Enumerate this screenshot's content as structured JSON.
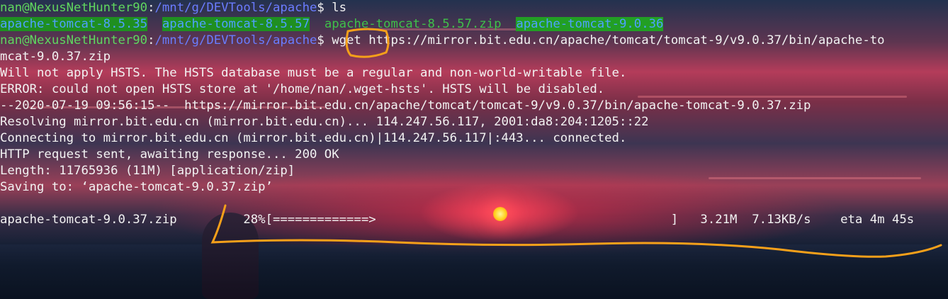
{
  "terminal": {
    "prompt_user": "nan@NexusNetHunter90",
    "prompt_sep": ":",
    "cwd": "/mnt/g/DEVTools/apache",
    "prompt_char": "$",
    "cmd1": " ls",
    "ls_items": [
      "apache-tomcat-8.5.35",
      "apache-tomcat-8.5.57",
      "apache-tomcat-8.5.57.zip",
      "apache-tomcat-9.0.36"
    ],
    "cmd2_keyword": "wget",
    "cmd2_url": " https://mirror.bit.edu.cn/apache/tomcat/tomcat-9/v9.0.37/bin/apache-to",
    "cmd2_wrap": "mcat-9.0.37.zip",
    "out1": "Will not apply HSTS. The HSTS database must be a regular and non-world-writable file.",
    "out2": "ERROR: could not open HSTS store at '/home/nan/.wget-hsts'. HSTS will be disabled.",
    "out3": "--2020-07-19 09:56:15--  https://mirror.bit.edu.cn/apache/tomcat/tomcat-9/v9.0.37/bin/apache-tomcat-9.0.37.zip",
    "out4": "Resolving mirror.bit.edu.cn (mirror.bit.edu.cn)... 114.247.56.117, 2001:da8:204:1205::22",
    "out5": "Connecting to mirror.bit.edu.cn (mirror.bit.edu.cn)|114.247.56.117|:443... connected.",
    "out6": "HTTP request sent, awaiting response... 200 OK",
    "out7": "Length: 11765936 (11M) [application/zip]",
    "out8": "Saving to: ‘apache-tomcat-9.0.37.zip’",
    "progress": {
      "filename": "apache-tomcat-9.0.37.zip",
      "percent": "28%",
      "bar": "[=============>                                        ]",
      "downloaded": "3.21M",
      "speed": "7.13KB/s",
      "eta": "eta 4m 45s",
      "fraction": 0.28
    }
  },
  "colors": {
    "user": "#5fd75f",
    "path": "#6a7cff",
    "selection": "#1f8f21",
    "annotation": "#f5a01a"
  },
  "icons": [
    "annotation-circle-icon",
    "annotation-underline-icon",
    "sun-icon"
  ]
}
